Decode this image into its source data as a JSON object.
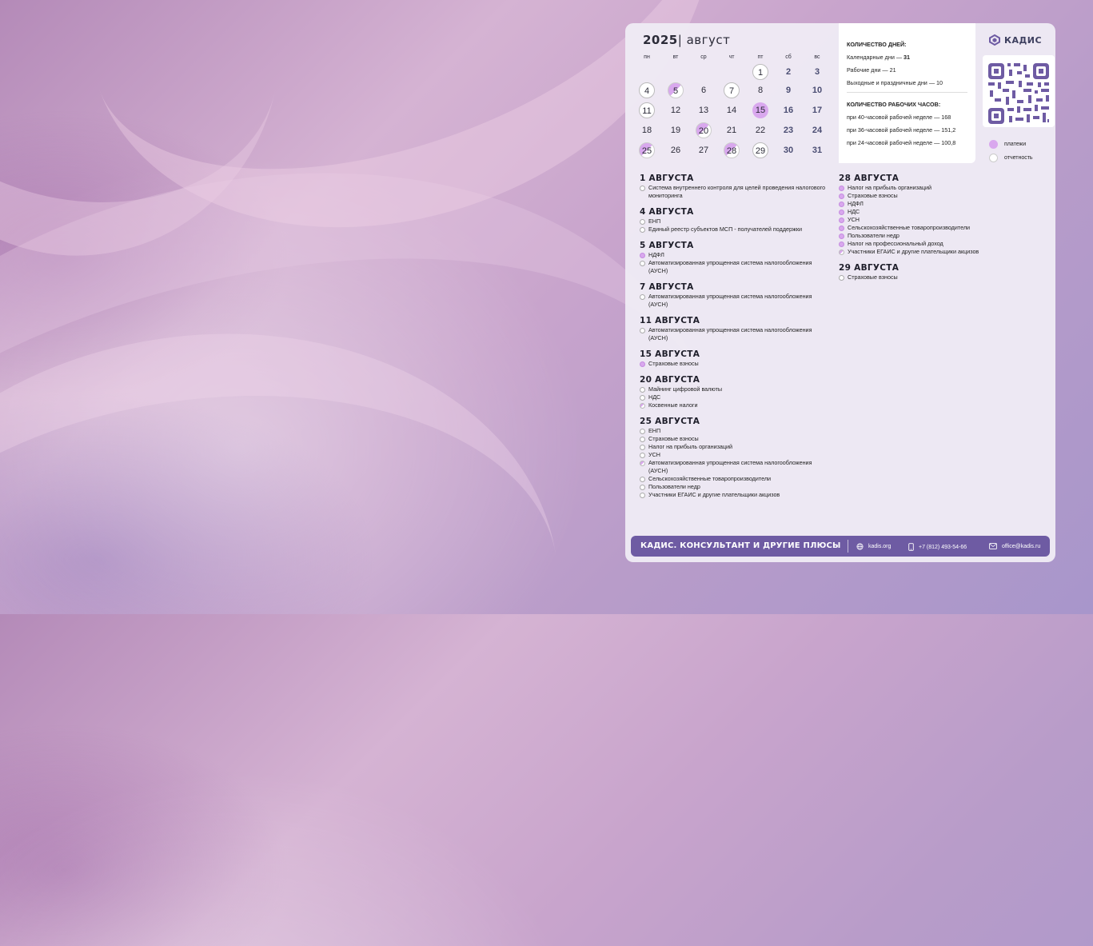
{
  "calendar": {
    "year": "2025",
    "month": "август",
    "weekdays": [
      "пн",
      "вт",
      "ср",
      "чт",
      "пт",
      "сб",
      "вс"
    ],
    "days": [
      {
        "n": "1",
        "kind": "rep"
      },
      {
        "n": "2",
        "kind": "we"
      },
      {
        "n": "3",
        "kind": "we"
      },
      {
        "n": "4",
        "kind": "rep"
      },
      {
        "n": "5",
        "kind": "mix"
      },
      {
        "n": "6",
        "kind": ""
      },
      {
        "n": "7",
        "kind": "rep"
      },
      {
        "n": "8",
        "kind": ""
      },
      {
        "n": "9",
        "kind": "we"
      },
      {
        "n": "10",
        "kind": "we"
      },
      {
        "n": "11",
        "kind": "rep"
      },
      {
        "n": "12",
        "kind": ""
      },
      {
        "n": "13",
        "kind": ""
      },
      {
        "n": "14",
        "kind": ""
      },
      {
        "n": "15",
        "kind": "pay"
      },
      {
        "n": "16",
        "kind": "we"
      },
      {
        "n": "17",
        "kind": "we"
      },
      {
        "n": "18",
        "kind": ""
      },
      {
        "n": "19",
        "kind": ""
      },
      {
        "n": "20",
        "kind": "mix"
      },
      {
        "n": "21",
        "kind": ""
      },
      {
        "n": "22",
        "kind": ""
      },
      {
        "n": "23",
        "kind": "we"
      },
      {
        "n": "24",
        "kind": "we"
      },
      {
        "n": "25",
        "kind": "mix"
      },
      {
        "n": "26",
        "kind": ""
      },
      {
        "n": "27",
        "kind": ""
      },
      {
        "n": "28",
        "kind": "mix"
      },
      {
        "n": "29",
        "kind": "rep"
      },
      {
        "n": "30",
        "kind": "we"
      },
      {
        "n": "31",
        "kind": "we"
      }
    ]
  },
  "info": {
    "days_heading": "КОЛИЧЕСТВО ДНЕЙ:",
    "calendar_days_label": "Календарные дни — ",
    "calendar_days_value": "31",
    "work_days": "Рабочие дни — 21",
    "holidays": "Выходные и праздничные дни — 10",
    "hours_heading": "КОЛИЧЕСТВО РАБОЧИХ ЧАСОВ:",
    "h40": "при 40-часовой рабочей неделе — 168",
    "h36": "при 36-часовой рабочей неделе — 151,2",
    "h24": "при 24-часовой рабочей неделе — 100,8"
  },
  "brand": {
    "logo_text": "КАДИС"
  },
  "legend": {
    "payments": "платежи",
    "reports": "отчетность"
  },
  "events_left": [
    {
      "date": "1 АВГУСТА",
      "items": [
        {
          "t": "Система внутреннего контроля для целей проведения налогового мониторинга",
          "k": "rep"
        }
      ]
    },
    {
      "date": "4 АВГУСТА",
      "items": [
        {
          "t": "ЕНП",
          "k": "rep"
        },
        {
          "t": "Единый реестр субъектов МСП - получателей поддержки",
          "k": "rep"
        }
      ]
    },
    {
      "date": "5 АВГУСТА",
      "items": [
        {
          "t": "НДФЛ",
          "k": "pay"
        },
        {
          "t": "Автоматизированная упрощенная система налогообложения (АУСН)",
          "k": "rep"
        }
      ]
    },
    {
      "date": "7 АВГУСТА",
      "items": [
        {
          "t": "Автоматизированная упрощенная система налогообложения (АУСН)",
          "k": "rep"
        }
      ]
    },
    {
      "date": "11 АВГУСТА",
      "items": [
        {
          "t": "Автоматизированная упрощенная система налогообложения (АУСН)",
          "k": "rep"
        }
      ]
    },
    {
      "date": "15 АВГУСТА",
      "items": [
        {
          "t": "Страховые взносы",
          "k": "pay"
        }
      ]
    },
    {
      "date": "20 АВГУСТА",
      "items": [
        {
          "t": "Майнинг цифровой валюты",
          "k": "rep"
        },
        {
          "t": "НДС",
          "k": "rep"
        },
        {
          "t": "Косвенные налоги",
          "k": "mix"
        }
      ]
    },
    {
      "date": "25 АВГУСТА",
      "items": [
        {
          "t": "ЕНП",
          "k": "rep"
        },
        {
          "t": "Страховые взносы",
          "k": "rep"
        },
        {
          "t": "Налог на прибыль организаций",
          "k": "rep"
        },
        {
          "t": "УСН",
          "k": "rep"
        },
        {
          "t": "Автоматизированная упрощенная система налогообложения (АУСН)",
          "k": "mix"
        },
        {
          "t": "Сельскохозяйственные товаропроизводители",
          "k": "rep"
        },
        {
          "t": "Пользователи недр",
          "k": "rep"
        },
        {
          "t": "Участники ЕГАИС и другие плательщики акцизов",
          "k": "rep"
        }
      ]
    }
  ],
  "events_right": [
    {
      "date": "28 АВГУСТА",
      "items": [
        {
          "t": "Налог на прибыль организаций",
          "k": "pay"
        },
        {
          "t": "Страховые взносы",
          "k": "pay"
        },
        {
          "t": "НДФЛ",
          "k": "pay"
        },
        {
          "t": "НДС",
          "k": "pay"
        },
        {
          "t": "УСН",
          "k": "pay"
        },
        {
          "t": "Сельскохозяйственные товаропроизводители",
          "k": "pay"
        },
        {
          "t": "Пользователи недр",
          "k": "pay"
        },
        {
          "t": "Налог на профессиональный доход",
          "k": "pay"
        },
        {
          "t": "Участники ЕГАИС и другие плательщики акцизов",
          "k": "mix"
        }
      ]
    },
    {
      "date": "29 АВГУСТА",
      "items": [
        {
          "t": "Страховые взносы",
          "k": "rep"
        }
      ]
    }
  ],
  "footer": {
    "title": "КАДИС. КОНСУЛЬТАНТ И ДРУГИЕ ПЛЮСЫ",
    "site": "kadis.org",
    "phone": "+7 (812) 493-54-66",
    "email": "office@kadis.ru"
  },
  "colors": {
    "accent": "#6e5ba3",
    "payment": "#d9a8ee"
  }
}
